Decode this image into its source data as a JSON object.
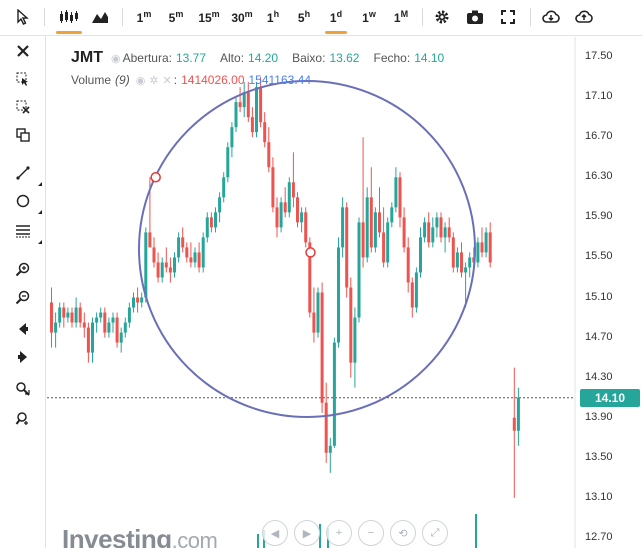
{
  "toolbar": {
    "timeframes": [
      "1m",
      "5m",
      "15m",
      "30m",
      "1h",
      "5h",
      "1d",
      "1w",
      "1M"
    ],
    "active_timeframe": "1d",
    "active_chart_type": "candles"
  },
  "legend": {
    "symbol": "JMT",
    "open_label": "Abertura",
    "open_value": "13.77",
    "high_label": "Alto",
    "high_value": "14.20",
    "low_label": "Baixo",
    "low_value": "13.62",
    "close_label": "Fecho",
    "close_value": "14.10",
    "volume_label": "Volume",
    "volume_param": "(9)",
    "volume_value": "1414026.00",
    "volume_ma_value": "1541163.44"
  },
  "price_axis": {
    "ticks": [
      "17.50",
      "17.10",
      "16.70",
      "16.30",
      "15.90",
      "15.50",
      "15.10",
      "14.70",
      "14.30",
      "13.90",
      "13.50",
      "13.10",
      "12.70"
    ],
    "current_price": "14.10"
  },
  "watermark": {
    "brand": "Investing",
    "suffix": ".com"
  },
  "colors": {
    "up": "#26a69a",
    "down": "#ef5350",
    "accent": "#f0a23a",
    "circle": "#6a6fb8"
  },
  "chart_data": {
    "type": "candlestick",
    "symbol": "JMT",
    "ylim": [
      12.6,
      17.7
    ],
    "current_price": 14.1,
    "candles": [
      [
        15.05,
        15.2,
        14.6,
        14.75
      ],
      [
        14.75,
        14.95,
        14.6,
        14.85
      ],
      [
        14.85,
        15.05,
        14.8,
        15.0
      ],
      [
        15.0,
        15.05,
        14.8,
        14.9
      ],
      [
        14.9,
        15.0,
        14.85,
        14.95
      ],
      [
        14.95,
        15.0,
        14.8,
        14.85
      ],
      [
        14.85,
        15.1,
        14.8,
        15.0
      ],
      [
        15.0,
        15.05,
        14.8,
        14.85
      ],
      [
        14.85,
        14.95,
        14.7,
        14.8
      ],
      [
        14.8,
        14.85,
        14.45,
        14.55
      ],
      [
        14.55,
        14.9,
        14.45,
        14.85
      ],
      [
        14.85,
        14.95,
        14.75,
        14.9
      ],
      [
        14.9,
        15.0,
        14.85,
        14.95
      ],
      [
        14.95,
        15.0,
        14.7,
        14.75
      ],
      [
        14.75,
        14.9,
        14.7,
        14.85
      ],
      [
        14.85,
        14.95,
        14.75,
        14.9
      ],
      [
        14.9,
        14.95,
        14.6,
        14.65
      ],
      [
        14.65,
        14.8,
        14.55,
        14.75
      ],
      [
        14.75,
        14.9,
        14.7,
        14.85
      ],
      [
        14.85,
        15.05,
        14.8,
        15.0
      ],
      [
        15.0,
        15.15,
        14.95,
        15.1
      ],
      [
        15.1,
        15.2,
        14.95,
        15.05
      ],
      [
        15.05,
        15.15,
        15.0,
        15.1
      ],
      [
        15.1,
        15.8,
        15.05,
        15.75
      ],
      [
        15.75,
        16.3,
        15.7,
        15.6
      ],
      [
        15.6,
        15.7,
        15.4,
        15.45
      ],
      [
        15.45,
        15.55,
        15.25,
        15.3
      ],
      [
        15.3,
        15.5,
        15.25,
        15.45
      ],
      [
        15.45,
        15.6,
        15.35,
        15.4
      ],
      [
        15.4,
        15.5,
        15.25,
        15.35
      ],
      [
        15.35,
        15.55,
        15.3,
        15.5
      ],
      [
        15.5,
        15.75,
        15.45,
        15.7
      ],
      [
        15.7,
        15.8,
        15.55,
        15.6
      ],
      [
        15.6,
        15.65,
        15.45,
        15.5
      ],
      [
        15.5,
        15.65,
        15.4,
        15.45
      ],
      [
        15.45,
        15.6,
        15.4,
        15.55
      ],
      [
        15.55,
        15.65,
        15.35,
        15.4
      ],
      [
        15.4,
        15.75,
        15.35,
        15.7
      ],
      [
        15.7,
        15.95,
        15.65,
        15.9
      ],
      [
        15.9,
        15.95,
        15.75,
        15.8
      ],
      [
        15.8,
        16.0,
        15.75,
        15.95
      ],
      [
        15.95,
        16.15,
        15.85,
        16.1
      ],
      [
        16.1,
        16.35,
        16.05,
        16.3
      ],
      [
        16.3,
        16.65,
        16.25,
        16.6
      ],
      [
        16.6,
        16.85,
        16.5,
        16.8
      ],
      [
        16.8,
        17.1,
        16.75,
        17.05
      ],
      [
        17.05,
        17.2,
        16.95,
        17.0
      ],
      [
        17.0,
        17.25,
        16.9,
        17.15
      ],
      [
        17.15,
        17.25,
        16.85,
        16.9
      ],
      [
        16.9,
        17.0,
        16.7,
        16.75
      ],
      [
        16.75,
        17.25,
        16.7,
        17.2
      ],
      [
        17.2,
        17.3,
        16.8,
        16.85
      ],
      [
        16.85,
        16.95,
        16.6,
        16.65
      ],
      [
        16.65,
        16.8,
        16.35,
        16.4
      ],
      [
        16.4,
        16.5,
        15.95,
        16.0
      ],
      [
        16.0,
        16.1,
        15.7,
        15.8
      ],
      [
        15.8,
        16.1,
        15.75,
        16.05
      ],
      [
        16.05,
        16.2,
        15.9,
        15.95
      ],
      [
        15.95,
        16.3,
        15.9,
        16.25
      ],
      [
        16.25,
        16.55,
        16.0,
        16.1
      ],
      [
        16.1,
        16.15,
        15.8,
        15.85
      ],
      [
        15.85,
        16.0,
        15.75,
        15.95
      ],
      [
        15.95,
        16.0,
        15.6,
        15.65
      ],
      [
        15.65,
        15.7,
        14.9,
        14.95
      ],
      [
        14.95,
        15.2,
        14.65,
        14.75
      ],
      [
        14.75,
        15.2,
        14.7,
        15.15
      ],
      [
        15.15,
        15.25,
        13.95,
        14.05
      ],
      [
        14.05,
        14.25,
        13.45,
        13.55
      ],
      [
        13.55,
        13.7,
        13.35,
        13.62
      ],
      [
        13.62,
        14.7,
        13.6,
        14.65
      ],
      [
        14.65,
        15.7,
        14.6,
        15.6
      ],
      [
        15.6,
        16.1,
        15.5,
        16.0
      ],
      [
        16.0,
        16.05,
        15.1,
        15.2
      ],
      [
        15.2,
        15.3,
        14.3,
        14.45
      ],
      [
        14.45,
        15.0,
        14.2,
        14.9
      ],
      [
        14.9,
        15.9,
        14.85,
        15.85
      ],
      [
        15.85,
        16.7,
        15.4,
        15.5
      ],
      [
        15.5,
        16.2,
        15.45,
        16.1
      ],
      [
        16.1,
        16.4,
        15.55,
        15.6
      ],
      [
        15.6,
        16.0,
        15.55,
        15.95
      ],
      [
        15.95,
        16.2,
        15.7,
        15.75
      ],
      [
        15.75,
        16.0,
        15.4,
        15.45
      ],
      [
        15.45,
        15.9,
        15.4,
        15.85
      ],
      [
        15.85,
        16.05,
        15.8,
        16.0
      ],
      [
        16.0,
        16.4,
        15.95,
        16.3
      ],
      [
        16.3,
        16.35,
        15.8,
        15.9
      ],
      [
        15.9,
        16.0,
        15.55,
        15.6
      ],
      [
        15.6,
        15.7,
        15.15,
        15.25
      ],
      [
        15.25,
        15.3,
        14.9,
        15.0
      ],
      [
        15.0,
        15.4,
        14.95,
        15.35
      ],
      [
        15.35,
        15.8,
        15.3,
        15.7
      ],
      [
        15.7,
        15.9,
        15.65,
        15.85
      ],
      [
        15.85,
        15.95,
        15.6,
        15.65
      ],
      [
        15.65,
        15.9,
        15.6,
        15.8
      ],
      [
        15.8,
        15.95,
        15.7,
        15.9
      ],
      [
        15.9,
        15.95,
        15.65,
        15.7
      ],
      [
        15.7,
        15.85,
        15.55,
        15.8
      ],
      [
        15.8,
        15.9,
        15.65,
        15.7
      ],
      [
        15.7,
        15.75,
        15.35,
        15.4
      ],
      [
        15.4,
        15.6,
        15.35,
        15.55
      ],
      [
        15.55,
        15.65,
        15.3,
        15.35
      ],
      [
        15.35,
        15.45,
        15.0,
        15.4
      ],
      [
        15.4,
        15.55,
        15.3,
        15.5
      ],
      [
        15.5,
        15.6,
        15.35,
        15.45
      ],
      [
        15.45,
        15.7,
        15.4,
        15.65
      ],
      [
        15.65,
        15.8,
        15.5,
        15.55
      ],
      [
        15.55,
        15.8,
        15.5,
        15.75
      ],
      [
        15.75,
        15.85,
        15.4,
        15.45
      ],
      [
        13.9,
        14.4,
        13.1,
        13.77
      ],
      [
        13.77,
        14.2,
        13.62,
        14.1
      ]
    ],
    "annotations": {
      "circle_center": [
        38,
        15.25
      ],
      "circle_radius_candles": 40,
      "markers": [
        [
          12,
          16.3
        ],
        [
          60,
          15.55
        ]
      ]
    }
  }
}
